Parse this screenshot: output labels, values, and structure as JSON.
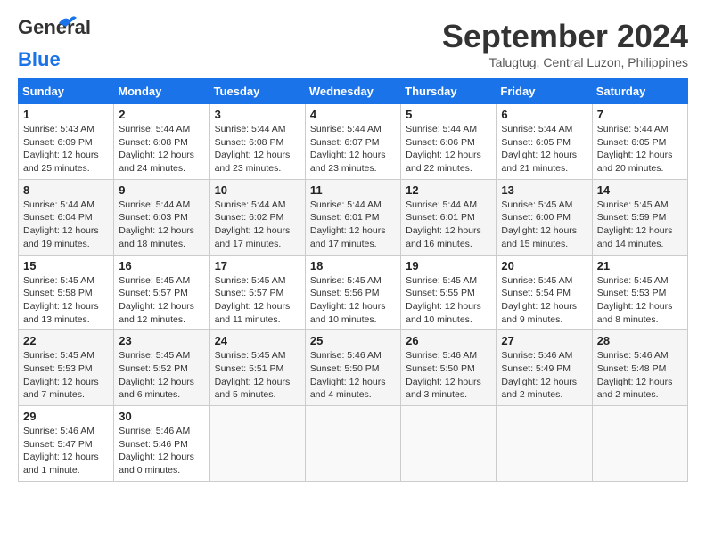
{
  "header": {
    "logo_general": "General",
    "logo_blue": "Blue",
    "month_title": "September 2024",
    "location": "Talugtug, Central Luzon, Philippines"
  },
  "weekdays": [
    "Sunday",
    "Monday",
    "Tuesday",
    "Wednesday",
    "Thursday",
    "Friday",
    "Saturday"
  ],
  "weeks": [
    [
      {
        "day": "1",
        "sunrise": "5:43 AM",
        "sunset": "6:09 PM",
        "daylight": "12 hours and 25 minutes."
      },
      {
        "day": "2",
        "sunrise": "5:44 AM",
        "sunset": "6:08 PM",
        "daylight": "12 hours and 24 minutes."
      },
      {
        "day": "3",
        "sunrise": "5:44 AM",
        "sunset": "6:08 PM",
        "daylight": "12 hours and 23 minutes."
      },
      {
        "day": "4",
        "sunrise": "5:44 AM",
        "sunset": "6:07 PM",
        "daylight": "12 hours and 23 minutes."
      },
      {
        "day": "5",
        "sunrise": "5:44 AM",
        "sunset": "6:06 PM",
        "daylight": "12 hours and 22 minutes."
      },
      {
        "day": "6",
        "sunrise": "5:44 AM",
        "sunset": "6:05 PM",
        "daylight": "12 hours and 21 minutes."
      },
      {
        "day": "7",
        "sunrise": "5:44 AM",
        "sunset": "6:05 PM",
        "daylight": "12 hours and 20 minutes."
      }
    ],
    [
      {
        "day": "8",
        "sunrise": "5:44 AM",
        "sunset": "6:04 PM",
        "daylight": "12 hours and 19 minutes."
      },
      {
        "day": "9",
        "sunrise": "5:44 AM",
        "sunset": "6:03 PM",
        "daylight": "12 hours and 18 minutes."
      },
      {
        "day": "10",
        "sunrise": "5:44 AM",
        "sunset": "6:02 PM",
        "daylight": "12 hours and 17 minutes."
      },
      {
        "day": "11",
        "sunrise": "5:44 AM",
        "sunset": "6:01 PM",
        "daylight": "12 hours and 17 minutes."
      },
      {
        "day": "12",
        "sunrise": "5:44 AM",
        "sunset": "6:01 PM",
        "daylight": "12 hours and 16 minutes."
      },
      {
        "day": "13",
        "sunrise": "5:45 AM",
        "sunset": "6:00 PM",
        "daylight": "12 hours and 15 minutes."
      },
      {
        "day": "14",
        "sunrise": "5:45 AM",
        "sunset": "5:59 PM",
        "daylight": "12 hours and 14 minutes."
      }
    ],
    [
      {
        "day": "15",
        "sunrise": "5:45 AM",
        "sunset": "5:58 PM",
        "daylight": "12 hours and 13 minutes."
      },
      {
        "day": "16",
        "sunrise": "5:45 AM",
        "sunset": "5:57 PM",
        "daylight": "12 hours and 12 minutes."
      },
      {
        "day": "17",
        "sunrise": "5:45 AM",
        "sunset": "5:57 PM",
        "daylight": "12 hours and 11 minutes."
      },
      {
        "day": "18",
        "sunrise": "5:45 AM",
        "sunset": "5:56 PM",
        "daylight": "12 hours and 10 minutes."
      },
      {
        "day": "19",
        "sunrise": "5:45 AM",
        "sunset": "5:55 PM",
        "daylight": "12 hours and 10 minutes."
      },
      {
        "day": "20",
        "sunrise": "5:45 AM",
        "sunset": "5:54 PM",
        "daylight": "12 hours and 9 minutes."
      },
      {
        "day": "21",
        "sunrise": "5:45 AM",
        "sunset": "5:53 PM",
        "daylight": "12 hours and 8 minutes."
      }
    ],
    [
      {
        "day": "22",
        "sunrise": "5:45 AM",
        "sunset": "5:53 PM",
        "daylight": "12 hours and 7 minutes."
      },
      {
        "day": "23",
        "sunrise": "5:45 AM",
        "sunset": "5:52 PM",
        "daylight": "12 hours and 6 minutes."
      },
      {
        "day": "24",
        "sunrise": "5:45 AM",
        "sunset": "5:51 PM",
        "daylight": "12 hours and 5 minutes."
      },
      {
        "day": "25",
        "sunrise": "5:46 AM",
        "sunset": "5:50 PM",
        "daylight": "12 hours and 4 minutes."
      },
      {
        "day": "26",
        "sunrise": "5:46 AM",
        "sunset": "5:50 PM",
        "daylight": "12 hours and 3 minutes."
      },
      {
        "day": "27",
        "sunrise": "5:46 AM",
        "sunset": "5:49 PM",
        "daylight": "12 hours and 2 minutes."
      },
      {
        "day": "28",
        "sunrise": "5:46 AM",
        "sunset": "5:48 PM",
        "daylight": "12 hours and 2 minutes."
      }
    ],
    [
      {
        "day": "29",
        "sunrise": "5:46 AM",
        "sunset": "5:47 PM",
        "daylight": "12 hours and 1 minute."
      },
      {
        "day": "30",
        "sunrise": "5:46 AM",
        "sunset": "5:46 PM",
        "daylight": "12 hours and 0 minutes."
      },
      null,
      null,
      null,
      null,
      null
    ]
  ]
}
